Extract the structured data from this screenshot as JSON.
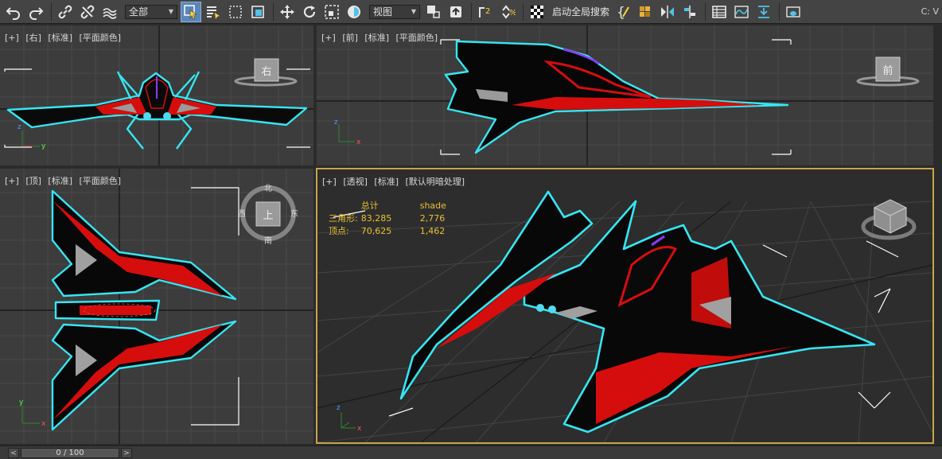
{
  "toolbar": {
    "selection_filter": "全部",
    "reference_coord": "视图",
    "auto_search_label": "启动全局搜索",
    "tail_text": "C: V"
  },
  "viewports": {
    "right": {
      "labels": [
        "[+]",
        "[右]",
        "[标准]",
        "[平面颜色]"
      ],
      "viewcube": "右"
    },
    "front": {
      "labels": [
        "[+]",
        "[前]",
        "[标准]",
        "[平面颜色]"
      ],
      "viewcube": "前"
    },
    "top": {
      "labels": [
        "[+]",
        "[顶]",
        "[标准]",
        "[平面颜色]"
      ],
      "viewcube": "上",
      "compass": {
        "n": "北",
        "s": "南",
        "e": "东",
        "w": "西"
      }
    },
    "persp": {
      "labels": [
        "[+]",
        "[透视]",
        "[标准]",
        "[默认明暗处理]"
      ]
    }
  },
  "stats": {
    "header_total": "总计",
    "header_shade": "shade",
    "rows": [
      {
        "label": "三角形:",
        "total": "83,285",
        "shade": "2,776"
      },
      {
        "label": "顶点:",
        "total": "70,625",
        "shade": "1,462"
      }
    ]
  },
  "axes": {
    "x": "x",
    "y": "y",
    "z": "z"
  },
  "timeline": {
    "frame": "0 / 100",
    "prev": "<",
    "next": ">"
  },
  "colors": {
    "selection_outline": "#35e6f2",
    "ship_red": "#e00d0d",
    "ship_black": "#050505",
    "active_viewport_border": "#c9a54a",
    "stats_text": "#e8c232"
  }
}
